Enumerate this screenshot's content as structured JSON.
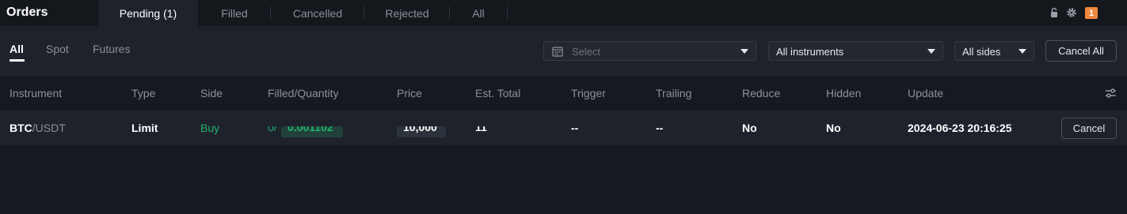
{
  "header": {
    "title": "Orders",
    "tabs": [
      {
        "label": "Pending (1)",
        "active": true
      },
      {
        "label": "Filled",
        "active": false
      },
      {
        "label": "Cancelled",
        "active": false
      },
      {
        "label": "Rejected",
        "active": false
      },
      {
        "label": "All",
        "active": false
      }
    ],
    "notification_count": "1",
    "icons": [
      "lock-icon",
      "gear-icon",
      "notification-icon"
    ]
  },
  "filters": {
    "subtabs": [
      {
        "label": "All",
        "active": true
      },
      {
        "label": "Spot",
        "active": false
      },
      {
        "label": "Futures",
        "active": false
      }
    ],
    "date_select_placeholder": "Select",
    "instrument_select_value": "All instruments",
    "side_select_value": "All sides",
    "cancel_all_label": "Cancel All"
  },
  "table": {
    "columns": [
      "Instrument",
      "Type",
      "Side",
      "Filled/Quantity",
      "Price",
      "Est. Total",
      "Trigger",
      "Trailing",
      "Reduce",
      "Hidden",
      "Update"
    ],
    "rows": [
      {
        "instrument_base": "BTC",
        "instrument_quote": "/USDT",
        "type": "Limit",
        "side": "Buy",
        "filled_prefix": "0/",
        "quantity": "0.001102",
        "price": "10,000",
        "est_total": "11",
        "trigger": "--",
        "trailing": "--",
        "reduce": "No",
        "hidden": "No",
        "update": "2024-06-23 20:16:25",
        "cancel_label": "Cancel"
      }
    ]
  },
  "colors": {
    "background": "#161a20",
    "panel": "#1e232b",
    "buy": "#20b26c",
    "badge": "#f0883e"
  }
}
